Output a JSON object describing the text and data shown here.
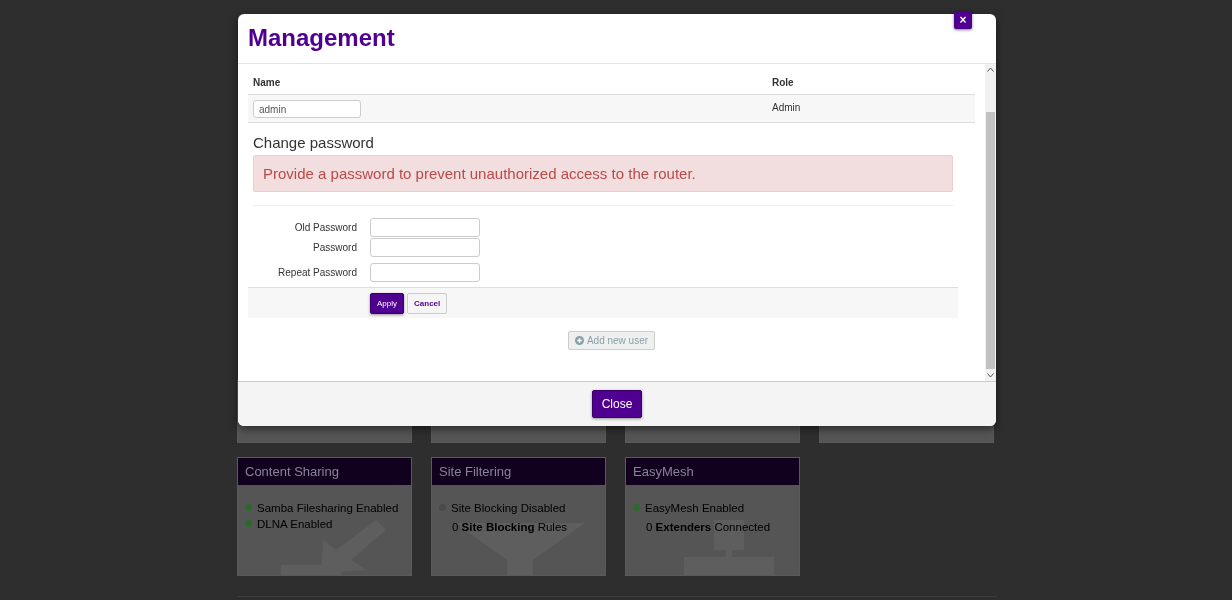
{
  "dialog": {
    "title": "Management",
    "close_glyph": "×",
    "table": {
      "columns": [
        "Name",
        "Role"
      ],
      "rows": [
        {
          "name": "admin",
          "role": "Admin"
        }
      ]
    },
    "change_password": {
      "heading": "Change password",
      "alert": "Provide a password to prevent unauthorized access to the router.",
      "fields": [
        {
          "label": "Old Password"
        },
        {
          "label": "Password"
        },
        {
          "label": "Repeat Password"
        }
      ],
      "buttons": [
        {
          "label": "Apply",
          "kind": "primary"
        },
        {
          "label": "Cancel",
          "kind": "default"
        }
      ]
    },
    "add_user": {
      "label": "Add new user",
      "disabled": true
    },
    "footer_button": "Close"
  },
  "background_cards": [
    {
      "title": "Content Sharing",
      "items": [
        {
          "kind": "status",
          "text": "Samba Filesharing Enabled",
          "color": "#2a6a2a"
        },
        {
          "kind": "status",
          "text": "DLNA Enabled",
          "color": "#2a6a2a"
        }
      ]
    },
    {
      "title": "Site Filtering",
      "items": [
        {
          "kind": "status",
          "text": "Site Blocking Disabled",
          "color": "#4a4a4a"
        },
        {
          "kind": "note",
          "text": "0 **Site Blocking** Rules"
        }
      ]
    },
    {
      "title": "EasyMesh",
      "items": [
        {
          "kind": "status",
          "text": "EasyMesh Enabled",
          "color": "#2a6a2a"
        },
        {
          "kind": "note",
          "text": "0 **Extenders** Connected"
        }
      ]
    }
  ]
}
